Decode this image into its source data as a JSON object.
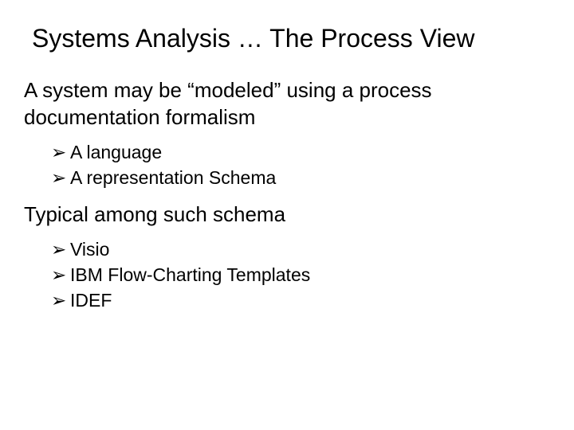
{
  "title": "Systems Analysis … The Process View",
  "para1": "A system may be “modeled” using a process documentation formalism",
  "list1": {
    "item0": "A language",
    "item1": "A representation Schema"
  },
  "para2": "Typical among such schema",
  "list2": {
    "item0": "Visio",
    "item1": "IBM Flow-Charting Templates",
    "item2": "IDEF"
  }
}
